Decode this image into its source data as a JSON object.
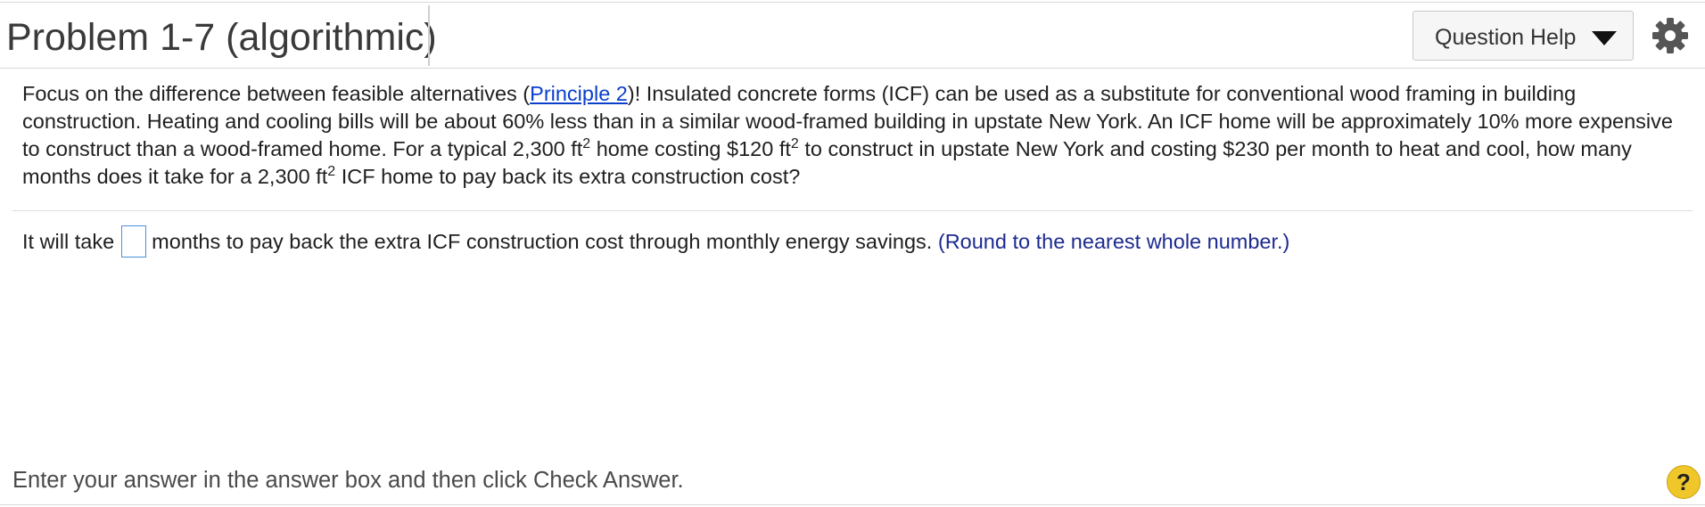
{
  "header": {
    "title": "Problem 1-7 (algorithmic)",
    "question_help_label": "Question Help",
    "caret_icon": "caret-down-icon",
    "settings_icon": "gear-icon"
  },
  "question": {
    "part1": "Focus on the difference between feasible alternatives (",
    "link_text": "Principle 2",
    "part2": ")! Insulated concrete forms (ICF) can be used as a substitute for conventional wood framing in building construction. Heating and cooling bills will be about 60% less than in a similar wood-framed building in upstate New York. An ICF home will be approximately 10% more expensive to construct than a wood-framed home. For a typical 2,300 ft",
    "sup1": "2",
    "part3": " home costing $120 ft",
    "sup2": "2",
    "part4": " to construct in upstate New York and costing $230 per month to heat and cool, how many months does it take for a 2,300 ft",
    "sup3": "2",
    "part5": " ICF home to pay back its extra construction cost?"
  },
  "answer": {
    "prefix": "It will take",
    "value": "",
    "suffix": "months to pay back the extra ICF construction cost through monthly energy savings.",
    "hint": "(Round to the nearest whole number.)"
  },
  "footer": {
    "instruction": "Enter your answer in the answer box and then click Check Answer.",
    "help_symbol": "?"
  },
  "colors": {
    "link": "#0a3fcc",
    "hint": "#1d2b8f",
    "input_border": "#4a90d9",
    "help_badge": "#f0c72a"
  }
}
